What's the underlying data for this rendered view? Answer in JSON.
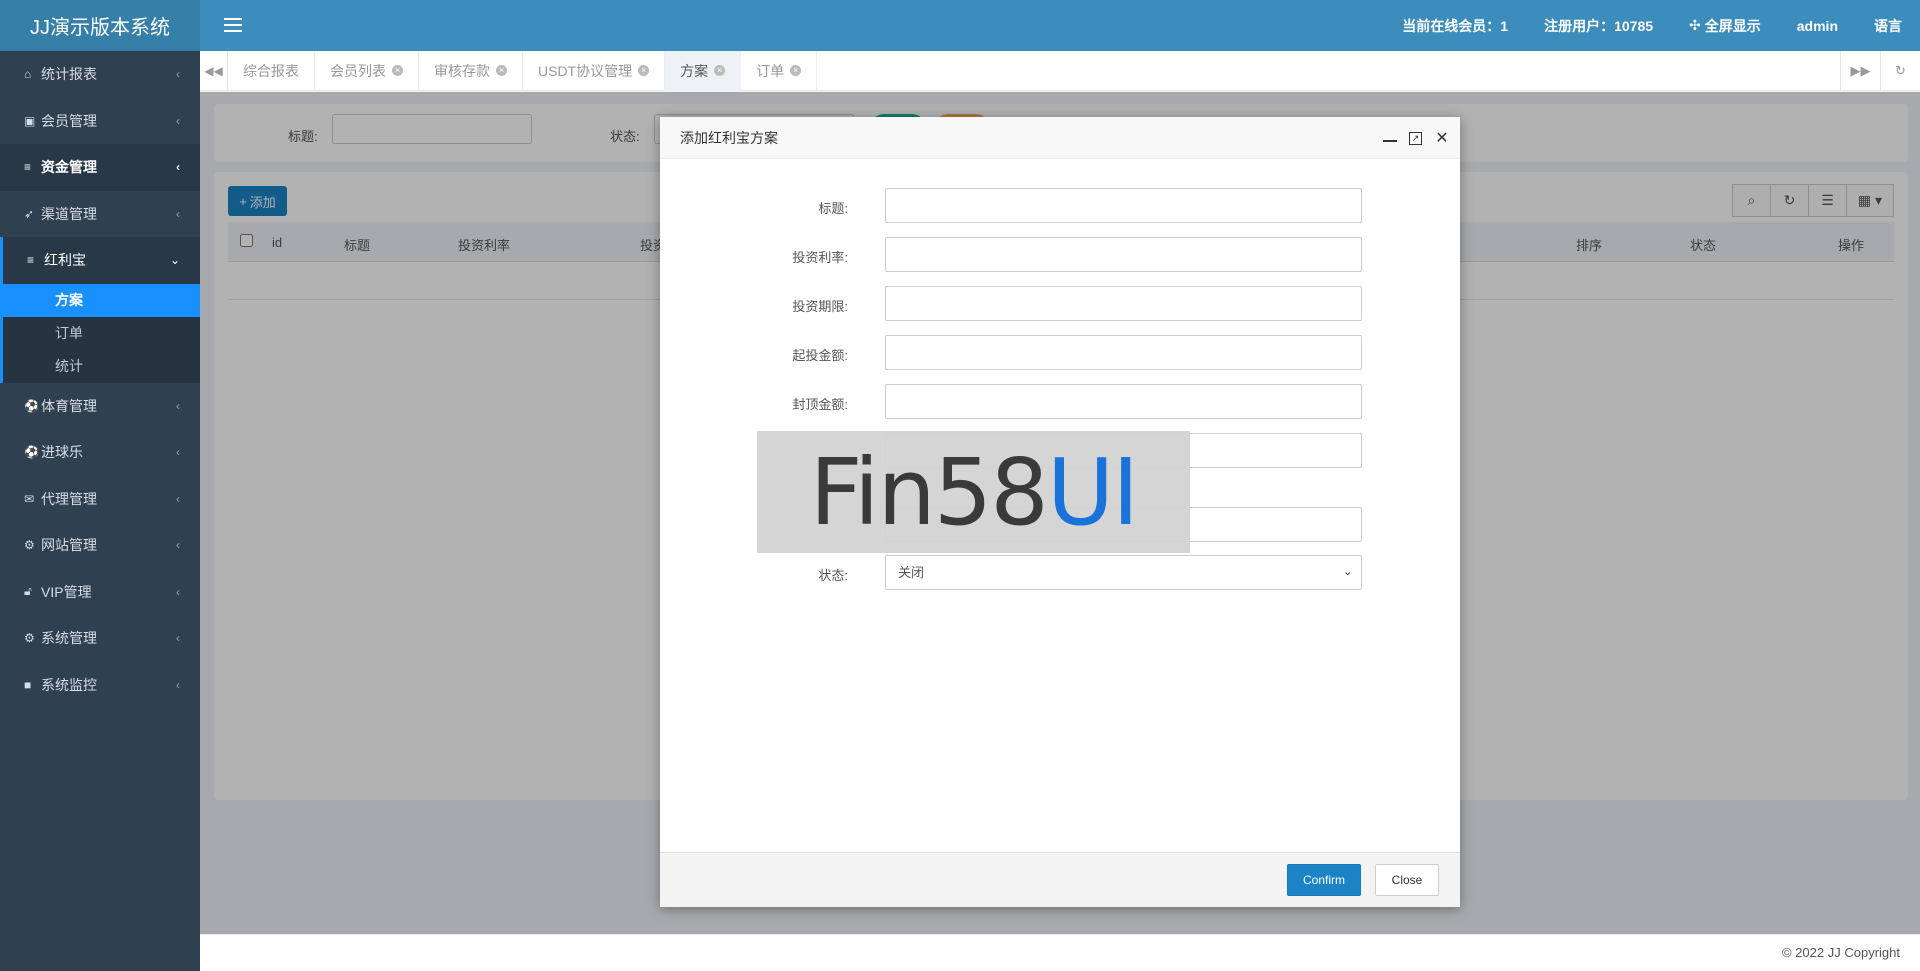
{
  "app": {
    "title": "JJ演示版本系统"
  },
  "header": {
    "online_members": "当前在线会员：1",
    "registered_users": "注册用户：10785",
    "fullscreen": "全屏显示",
    "user": "admin",
    "language": "语言"
  },
  "sidebar": {
    "items": [
      {
        "label": "统计报表",
        "icon": "home-icon"
      },
      {
        "label": "会员管理",
        "icon": "id-card-icon"
      },
      {
        "label": "资金管理",
        "icon": "database-icon"
      },
      {
        "label": "渠道管理",
        "icon": "rocket-icon"
      },
      {
        "label": "红利宝",
        "icon": "database-icon"
      },
      {
        "label": "体育管理",
        "icon": "soccer-icon"
      },
      {
        "label": "进球乐",
        "icon": "soccer-icon"
      },
      {
        "label": "代理管理",
        "icon": "envelope-icon"
      },
      {
        "label": "网站管理",
        "icon": "gears-icon"
      },
      {
        "label": "VIP管理",
        "icon": "lock-icon"
      },
      {
        "label": "系统管理",
        "icon": "gear-icon"
      },
      {
        "label": "系统监控",
        "icon": "video-icon"
      }
    ],
    "submenu": [
      "方案",
      "订单",
      "统计"
    ]
  },
  "tabs": [
    "综合报表",
    "会员列表",
    "审核存款",
    "USDT协议管理",
    "方案",
    "订单"
  ],
  "search": {
    "title_label": "标题:",
    "status_label": "状态:"
  },
  "toolbar": {
    "add_label": "添加"
  },
  "table": {
    "headers": [
      "id",
      "标题",
      "投资利率",
      "投资",
      "排序",
      "状态",
      "操作"
    ]
  },
  "modal": {
    "title": "添加红利宝方案",
    "fields": {
      "title": "标题:",
      "rate": "投资利率:",
      "term": "投资期限:",
      "min_amount": "起投金额:",
      "max_amount": "封顶金额:",
      "status": "状态:"
    },
    "status_value": "关闭",
    "confirm": "Confirm",
    "close": "Close"
  },
  "watermark": {
    "part_a": "Fin58",
    "part_b": "UI"
  },
  "footer": {
    "copyright": "© 2022 JJ Copyright"
  }
}
